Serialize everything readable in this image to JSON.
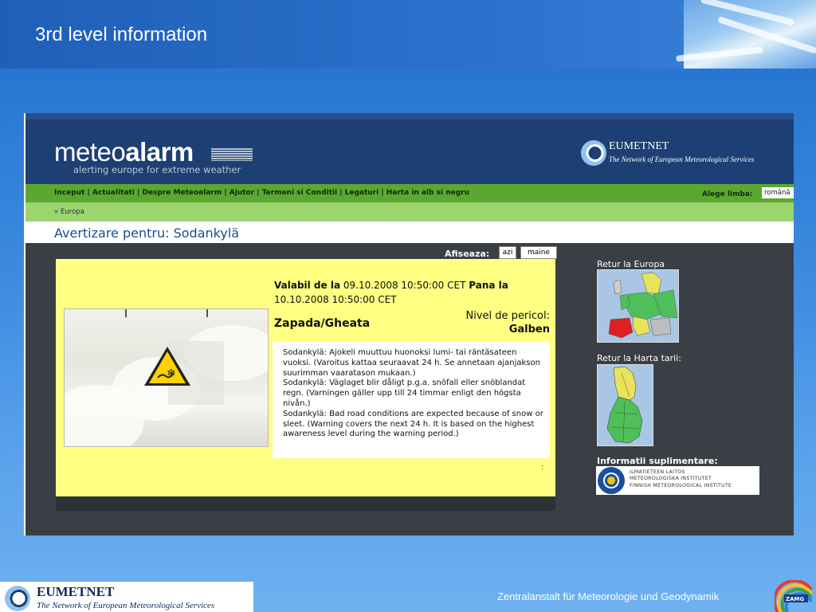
{
  "slide": {
    "title": "3rd level information",
    "footer_left_name": "EUMETNET",
    "footer_left_sub": "The Network of European Meteorological Services",
    "footer_right_text": "Zentralanstalt für Meteorologie und Geodynamik",
    "footer_right_logo_text": "ZAMG"
  },
  "site": {
    "logo_light": "meteo",
    "logo_bold": "alarm",
    "tagline": "alerting europe for extreme weather",
    "partner_name": "EUMETNET",
    "partner_sub": "The Network of European Meteorological Services",
    "nav_links": "Inceput | Actualitati | Despre Meteoalarm | Ajutor | Termeni si Conditii | Legaturi | Harta in alb si negru",
    "language_label": "Alege limba:",
    "language_selected": "română",
    "breadcrumb": "» Europa",
    "page_title": "Avertizare pentru: Sodankylä"
  },
  "warning": {
    "show_label": "Afiseaza:",
    "tab_today": "azi",
    "tab_tomorrow": "maine",
    "valid_from_label": "Valabil de la",
    "valid_from": "09.10.2008 10:50:00 CET",
    "valid_to_label": "Pana la",
    "valid_to": "10.10.2008 10:50:00 CET",
    "hazard_type": "Zapada/Gheata",
    "level_label": "Nivel de pericol:",
    "level_value": "Galben",
    "level_color": "#ffff82",
    "description_fi": "Sodankylä: Ajokeli muuttuu huonoksi lumi- tai räntäsateen vuoksi. (Varoitus kattaa seuraavat 24 h. Se annetaan ajanjakson suurimman vaaratason mukaan.)",
    "description_sv": "Sodankylä: Väglaget blir dåligt p.g.a. snöfall eller snöblandat regn. (Varningen gäller upp till 24 timmar enligt den högsta nivån.)",
    "description_en": "Sodankylä: Bad road conditions are expected because of snow or sleet. (Warning covers the next 24 h. It is based on the highest awareness level during the warning period.)",
    "trailing_mark": ":"
  },
  "sidebar": {
    "return_europe": "Retur la Europa",
    "return_country": "Retur la Harta tarii:",
    "more_info": "Informatii suplimentare:",
    "fmi_line1": "ILMATIETEEN LAITOS",
    "fmi_line2": "METEOROLOGISKA INSTITUTET",
    "fmi_line3": "FINNISH METEOROLOGICAL INSTITUTE"
  }
}
